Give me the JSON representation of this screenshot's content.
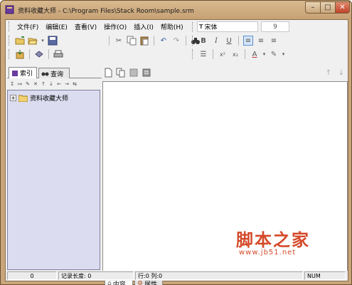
{
  "window": {
    "title": "资料收藏大师 - C:\\Program Files\\Stack Room\\sample.srm",
    "buttons": {
      "minimize": "–",
      "maximize": "□",
      "close": "✕"
    }
  },
  "menu": {
    "items": [
      "文件(F)",
      "编辑(E)",
      "查看(V)",
      "操作(O)",
      "插入(I)",
      "帮助(H)"
    ]
  },
  "font": {
    "name": "宋体",
    "size": "9"
  },
  "toolbar": {
    "row1_left": [
      "new-folder-icon",
      "open-icon",
      "dropdown-icon",
      "save-icon"
    ],
    "row1_edit": [
      "cut-icon",
      "copy-icon",
      "paste-icon",
      "undo-icon",
      "redo-icon",
      "find-icon"
    ],
    "row2_left": [
      "import-icon",
      "export-icon",
      "print-icon"
    ],
    "format": {
      "bold": "B",
      "italic": "I",
      "underline": "U",
      "align_left": "≡",
      "align_center": "≡",
      "align_right": "≡"
    },
    "format2": [
      "bullets-icon",
      "superscript-icon",
      "subscript-icon",
      "font-color-icon",
      "highlight-icon"
    ]
  },
  "left_panel": {
    "tabs": [
      {
        "label": "索引",
        "active": true
      },
      {
        "label": "查询",
        "active": false
      }
    ],
    "tree_toolbar": [
      "↧",
      "↦",
      "✎",
      "✕",
      "↑",
      "↓",
      "←",
      "→",
      "⇆"
    ],
    "tree": [
      {
        "label": "资料收藏大师",
        "expander": "+"
      }
    ]
  },
  "document": {
    "toolbar": [
      "doc-new-icon",
      "doc-copy-icon",
      "doc-delete-icon",
      "doc-props-icon"
    ],
    "nav": [
      "↑",
      "↓"
    ],
    "bottom_tabs": [
      {
        "label": "内容",
        "active": true
      },
      {
        "label": "属性",
        "active": false
      }
    ]
  },
  "watermark": {
    "title": "脚本之家",
    "url": "www.jb51.net"
  },
  "statusbar": {
    "count": "0",
    "record_length": "记录长度: 0",
    "position": "行:0  列:0",
    "num": "NUM"
  },
  "colors": {
    "frame": "#c8a57a",
    "tree_bg": "#dcdcf0",
    "watermark": "#d44a2a"
  }
}
